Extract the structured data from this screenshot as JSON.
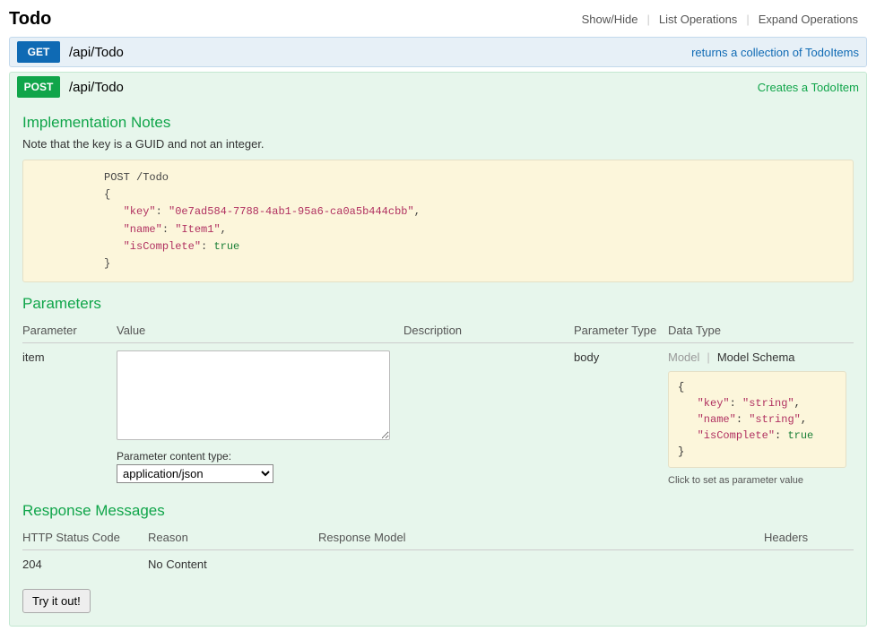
{
  "resource": {
    "title": "Todo"
  },
  "header_links": {
    "show_hide": "Show/Hide",
    "list_ops": "List Operations",
    "expand_ops": "Expand Operations"
  },
  "ops": {
    "get": {
      "method": "GET",
      "path": "/api/Todo",
      "desc": "returns a collection of TodoItems"
    },
    "post": {
      "method": "POST",
      "path": "/api/Todo",
      "desc": "Creates a TodoItem"
    }
  },
  "impl": {
    "title": "Implementation Notes",
    "text": "Note that the key is a GUID and not an integer.",
    "code_line0": "POST /Todo",
    "code_line1": "{",
    "code_key_key": "\"key\"",
    "code_key_val": "\"0e7ad584-7788-4ab1-95a6-ca0a5b444cbb\"",
    "code_name_key": "\"name\"",
    "code_name_val": "\"Item1\"",
    "code_ic_key": "\"isComplete\"",
    "code_ic_val": "true",
    "code_line5": "}"
  },
  "params": {
    "title": "Parameters",
    "h_param": "Parameter",
    "h_value": "Value",
    "h_desc": "Description",
    "h_ptype": "Parameter Type",
    "h_dtype": "Data Type",
    "row": {
      "name": "item",
      "value": "",
      "desc": "",
      "ptype": "body"
    },
    "ct_label": "Parameter content type:",
    "ct_value": "application/json",
    "model_tab": "Model",
    "schema_tab": "Model Schema",
    "schema_open": "{",
    "schema_key_key": "\"key\"",
    "schema_key_val": "\"string\"",
    "schema_name_key": "\"name\"",
    "schema_name_val": "\"string\"",
    "schema_ic_key": "\"isComplete\"",
    "schema_ic_val": "true",
    "schema_close": "}",
    "click_hint": "Click to set as parameter value"
  },
  "resp": {
    "title": "Response Messages",
    "h_code": "HTTP Status Code",
    "h_reason": "Reason",
    "h_model": "Response Model",
    "h_headers": "Headers",
    "row": {
      "code": "204",
      "reason": "No Content"
    }
  },
  "try_label": "Try it out!"
}
